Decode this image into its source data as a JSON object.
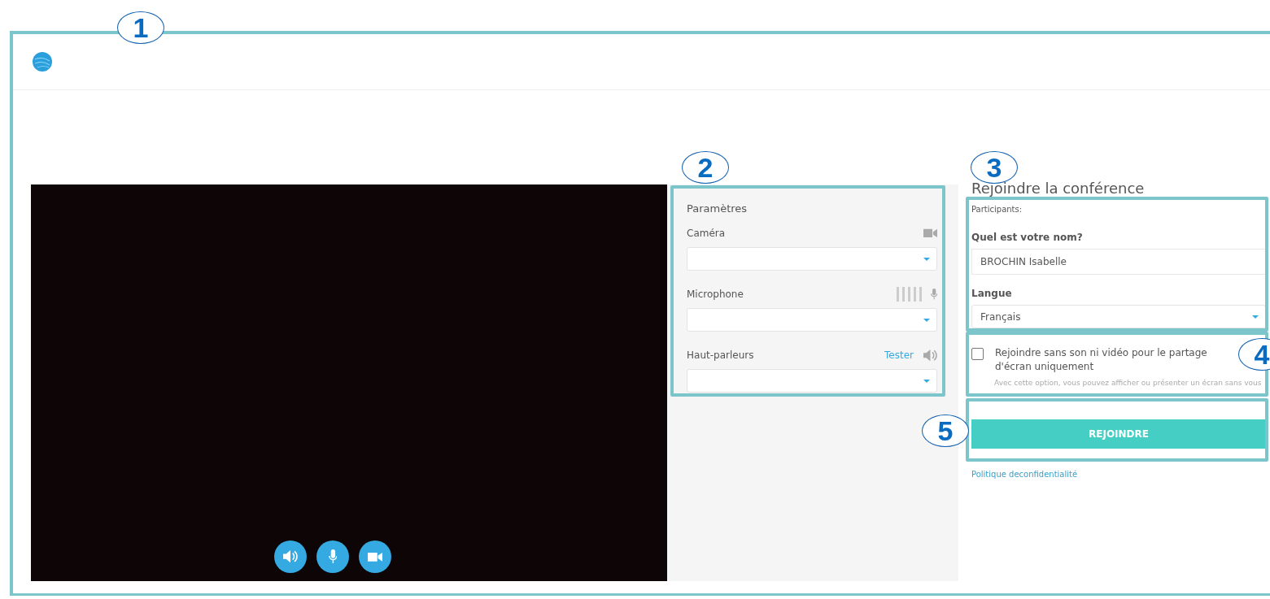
{
  "annotations": [
    {
      "label": "1"
    },
    {
      "label": "2"
    },
    {
      "label": "3"
    },
    {
      "label": "4"
    },
    {
      "label": "5"
    }
  ],
  "video": {
    "controls": [
      {
        "kind": "speaker"
      },
      {
        "kind": "microphone"
      },
      {
        "kind": "camera"
      }
    ]
  },
  "settings": {
    "title": "Paramètres",
    "devices": [
      {
        "kind": "camera",
        "label": "Caméra"
      },
      {
        "kind": "microphone",
        "label": "Microphone"
      },
      {
        "kind": "speaker",
        "label": "Haut-parleurs",
        "action": "Tester"
      }
    ]
  },
  "join": {
    "title": "Rejoindre la conférence",
    "participants_label": "Participants:",
    "name_label": "Quel est votre nom?",
    "name_value": "BROCHIN Isabelle",
    "language_label": "Langue",
    "language_value": "Français",
    "screen_only": {
      "label": "Rejoindre sans son ni vidéo pour le partage d'écran uniquement",
      "checked": false,
      "hint": "Avec cette option, vous pouvez afficher ou présenter un écran sans vous"
    },
    "button": "REJOINDRE",
    "privacy_link": "Politique deconfidentialité"
  }
}
